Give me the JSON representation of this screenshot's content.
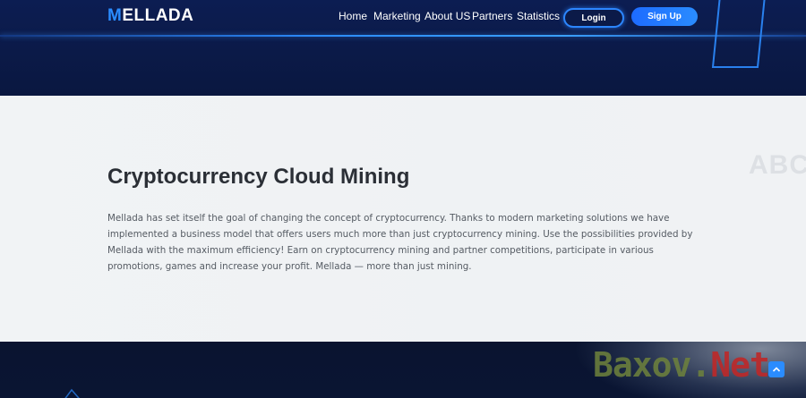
{
  "header": {
    "logo_main": "MELLADA",
    "nav": [
      "Home",
      "Marketing",
      "About US",
      "Partners",
      "Statistics"
    ],
    "login_label": "Login",
    "signup_label": "Sign Up"
  },
  "main": {
    "background_word": "ABC",
    "title": "Cryptocurrency Cloud Mining",
    "paragraph": "Mellada has set itself the goal of changing the concept of cryptocurrency. Thanks to modern marketing solutions we have implemented a business model that offers users much more than just cryptocurrency mining. Use the possibilities provided by Mellada with the maximum efficiency! Earn on cryptocurrency mining and partner competitions, participate in various promotions, games and increase your profit. Mellada — more than just mining."
  },
  "watermark": {
    "part1": "Baxov.",
    "part2": "Net"
  },
  "colors": {
    "header_bg": "#0b1a48",
    "accent": "#2a8cff",
    "content_bg": "#eff2f5",
    "footer_bg": "#0a1430"
  },
  "icons": {
    "scroll_top": "chevron-up-icon"
  }
}
